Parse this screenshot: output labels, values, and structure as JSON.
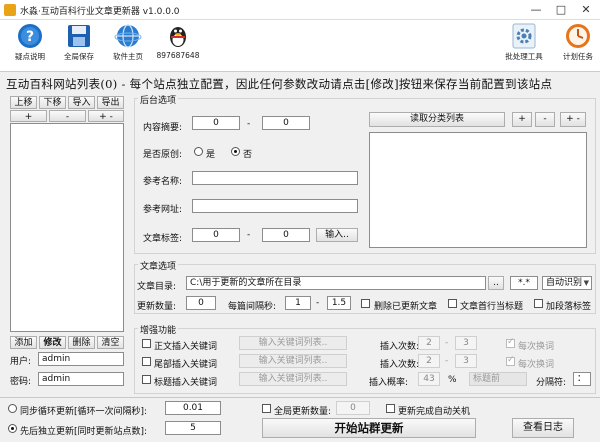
{
  "window": {
    "title": "水淼·互动百科行业文章更新器 v1.0.0.0",
    "minimize": "—",
    "maximize": "□",
    "close": "✕"
  },
  "toolbar": {
    "tips": "疑点说明",
    "save": "全局保存",
    "homepage": "软件主页",
    "qq": "897687648",
    "batch": "批处理工具",
    "schedule": "计划任务"
  },
  "banner": "互动百科网站列表(0) - 每个站点独立配置，因此任何参数改动请点击[修改]按钮来保存当前配置到该站点",
  "left": {
    "move_up": "上移",
    "move_down": "下移",
    "import": "导入",
    "export": "导出",
    "add": "+",
    "minus": "-",
    "plusminus": "+ -",
    "btn_add": "添加",
    "btn_edit": "修改",
    "btn_delete": "删除",
    "btn_clear": "清空",
    "user_label": "用户:",
    "user_value": "admin",
    "pass_label": "密码:",
    "pass_value": "admin"
  },
  "backend": {
    "title": "后台选项",
    "summary_label": "内容摘要:",
    "summary_from": "0",
    "summary_to": "0",
    "dash": "-",
    "original_label": "是否原创:",
    "opt_yes": "是",
    "opt_no": "否",
    "ref_name_label": "参考名称:",
    "ref_url_label": "参考网址:",
    "tags_label": "文章标签:",
    "tags_from": "0",
    "tags_to": "0",
    "tags_btn": "输入..",
    "read_categories": "读取分类列表",
    "cat_add": "+",
    "cat_minus": "-",
    "cat_pm": "+ -"
  },
  "article": {
    "title": "文章选项",
    "dir_label": "文章目录:",
    "dir_value": "C:\\用于更新的文章所在目录",
    "dir_btn": "..",
    "ext_value": "*.*",
    "encoding": "自动识别",
    "count_label": "更新数量:",
    "count_value": "0",
    "interval_label": "每篇间隔秒:",
    "interval_from": "1",
    "interval_to": "1.5",
    "delete_updated": "删除已更新文章",
    "first_line_title": "文章首行当标题",
    "add_paragraph_tag": "加段落标签"
  },
  "enhance": {
    "title": "增强功能",
    "row1_chk": "正文插入关键词",
    "row2_chk": "尾部插入关键词",
    "row3_chk": "标题插入关键词",
    "kw_btn": "输入关键词列表..",
    "insert_times": "插入次数:",
    "t_from": "2",
    "t_to": "3",
    "per_change": "每次换词",
    "insert_prob": "插入概率:",
    "prob_value": "43",
    "pct": "%",
    "title_front": "标题前",
    "separator_label": "分隔符:",
    "separator_value": "："
  },
  "bottom": {
    "sync_label": "同步循环更新[循环一次间隔秒]:",
    "sync_value": "0.01",
    "independent_label": "先后独立更新[同时更新站点数]:",
    "independent_value": "5",
    "global_count_label": "全局更新数量:",
    "global_count_value": "0",
    "auto_shutdown": "更新完成自动关机",
    "start": "开始站群更新",
    "log": "查看日志"
  },
  "colors": {
    "accent": "#1e6fc4",
    "orange": "#e8741a"
  }
}
